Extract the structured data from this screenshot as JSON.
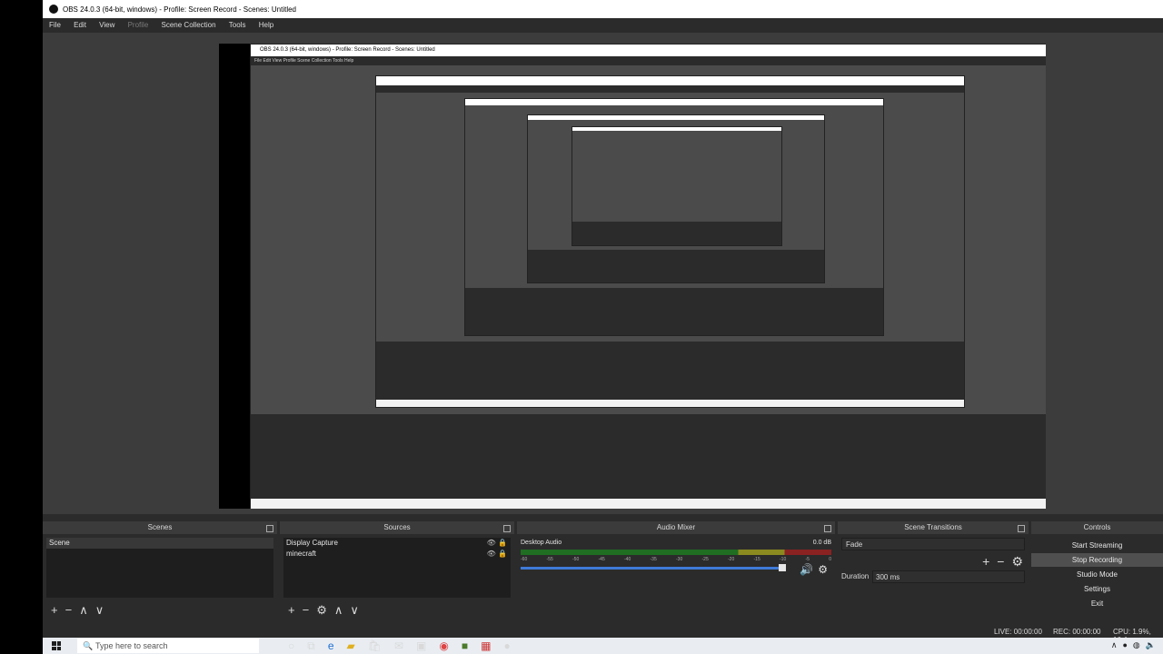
{
  "window": {
    "title": "OBS 24.0.3 (64-bit, windows) - Profile: Screen Record - Scenes: Untitled"
  },
  "menu": [
    "File",
    "Edit",
    "View",
    "Profile",
    "Scene Collection",
    "Tools",
    "Help"
  ],
  "preview": {
    "nested_title": "OBS 24.0.3 (64-bit, windows) - Profile: Screen Record - Scenes: Untitled"
  },
  "scenes": {
    "title": "Scenes",
    "items": [
      "Scene"
    ]
  },
  "sources": {
    "title": "Sources",
    "items": [
      "Display Capture",
      "minecraft"
    ]
  },
  "mixer": {
    "title": "Audio Mixer",
    "channel": "Desktop Audio",
    "level": "0.0 dB",
    "ticks": [
      "-60",
      "-55",
      "-50",
      "-45",
      "-40",
      "-35",
      "-30",
      "-25",
      "-20",
      "-15",
      "-10",
      "-5",
      "0"
    ]
  },
  "transitions": {
    "title": "Scene Transitions",
    "selected": "Fade",
    "duration_label": "Duration",
    "duration_value": "300 ms"
  },
  "controls": {
    "title": "Controls",
    "buttons": [
      "Start Streaming",
      "Stop Recording",
      "Studio Mode",
      "Settings",
      "Exit"
    ]
  },
  "status": {
    "live": "LIVE: 00:00:00",
    "rec": "REC: 00:00:00",
    "cpu": "CPU: 1.9%, 16.4"
  },
  "taskbar": {
    "search_placeholder": "Type here to search"
  },
  "toolbar": {
    "add": "+",
    "remove": "−",
    "up": "∧",
    "down": "∨",
    "gear": "⚙"
  }
}
